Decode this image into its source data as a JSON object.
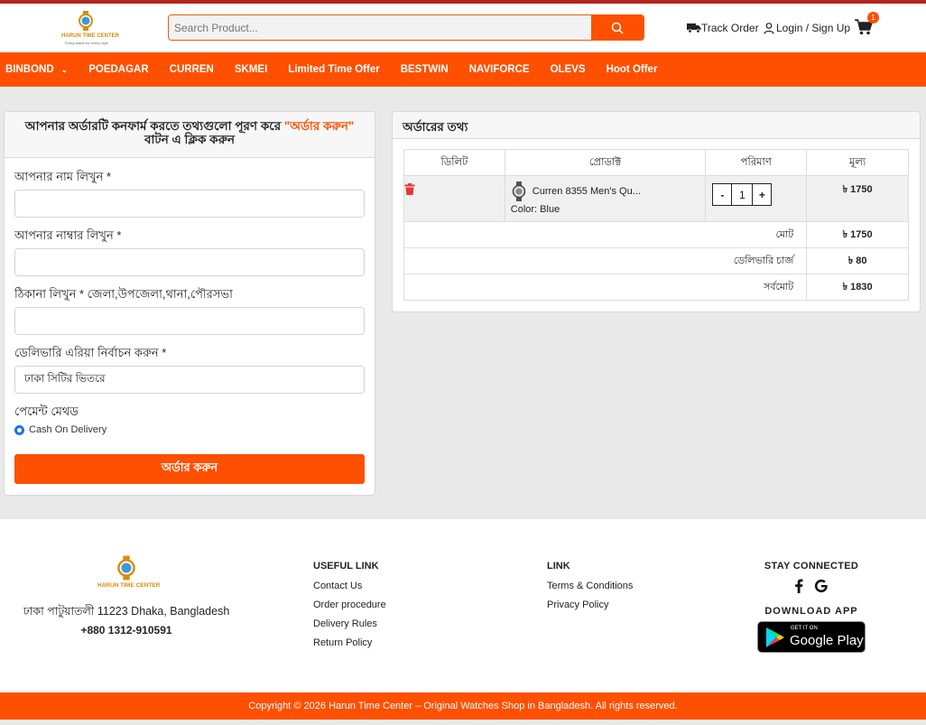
{
  "header": {
    "logo_text": "HARUN TIME CENTER",
    "logo_tagline": "Every watch for every style",
    "search_placeholder": "Search Product...",
    "track_order": "Track Order",
    "login": "Login / Sign Up",
    "cart_count": "1"
  },
  "nav": {
    "items": [
      "BINBOND",
      "POEDAGAR",
      "CURREN",
      "SKMEI",
      "Limited Time Offer",
      "BESTWIN",
      "NAVIFORCE",
      "OLEVS",
      "Hoot Offer"
    ]
  },
  "form": {
    "heading_part1": "আপনার অর্ডারটি কনফার্ম করতে তথ্যগুলো পূরণ করে ",
    "heading_highlight": "\"অর্ডার করুন\"",
    "heading_part2": "বাটন এ ক্লিক করুন",
    "name_label": "আপনার নাম লিখুন *",
    "phone_label": "আপনার নাম্বার লিখুন *",
    "address_label": "ঠিকানা লিখুন * জেলা,উপজেলা,থানা,পৌরসভা",
    "area_label": "ডেলিভারি এরিয়া নির্বাচন করুন *",
    "area_value": "ঢাকা সিটির ভিতরে",
    "payment_label": "পেমেন্ট মেথড",
    "payment_option": "Cash On Delivery",
    "submit": "অর্ডার করুন"
  },
  "order": {
    "title": "অর্ডারের তথ্য",
    "columns": [
      "ডিলিট",
      "প্রোডাক্ট",
      "পরিমাণ",
      "মূল্য"
    ],
    "product_name": "Curren 8355 Men's Qu...",
    "product_color": "Color: Blue",
    "quantity": "1",
    "qty_minus": "-",
    "qty_plus": "+",
    "price": "৳ 1750",
    "total_label": "মোট",
    "total_value": "৳ 1750",
    "delivery_label": "ডেলিভারি চার্জ",
    "delivery_value": "৳ 80",
    "grand_label": "সর্বমোট",
    "grand_value": "৳ 1830"
  },
  "footer": {
    "address": "ঢাকা পাটুয়াতলী 11223 Dhaka, Bangladesh",
    "phone": "+880 1312-910591",
    "useful_title": "USEFUL LINK",
    "useful_links": [
      "Contact Us",
      "Order procedure",
      "Delivery Rules",
      "Return Policy"
    ],
    "link_title": "LINK",
    "links": [
      "Terms & Conditions",
      "Privacy Policy"
    ],
    "stay_connected": "STAY CONNECTED",
    "download_app": "DOWNLOAD APP",
    "gplay_small": "GET IT ON",
    "gplay_big": "Google Play",
    "copyright": "Copyright © 2026 Harun Time Center – Original Watches Shop in Bangladesh. All rights reserved."
  },
  "colors": {
    "accent": "#fe5000",
    "topline": "#b3261e",
    "delete": "#e53935"
  }
}
